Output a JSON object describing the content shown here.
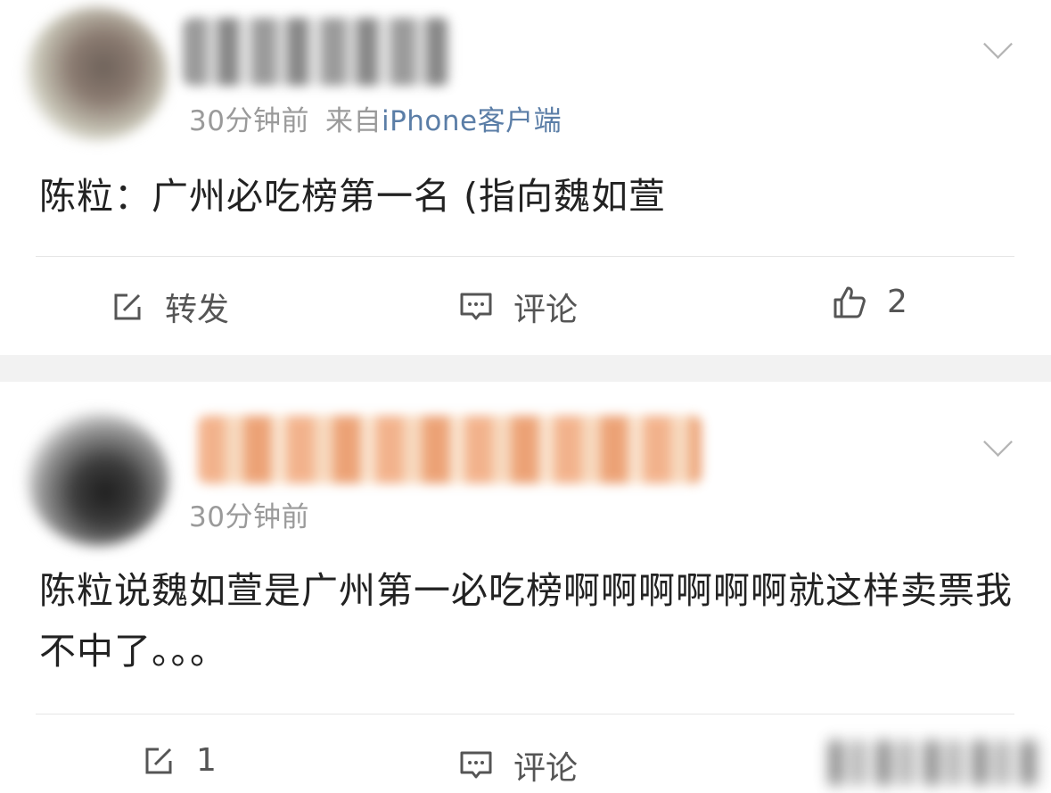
{
  "posts": [
    {
      "time": "30分钟前",
      "source_prefix": "来自",
      "source_client": "iPhone客户端",
      "content": "陈粒：广州必吃榜第一名 (指向魏如萱",
      "actions": {
        "repost": "转发",
        "comment": "评论",
        "like": "2"
      }
    },
    {
      "time": "30分钟前",
      "content": "陈粒说魏如萱是广州第一必吃榜啊啊啊啊啊啊就这样卖票我不中了。。。",
      "actions": {
        "repost": "1",
        "comment": "评论"
      }
    }
  ],
  "colors": {
    "link": "#5b7ea7",
    "meta": "#9a9a9a",
    "text": "#222222",
    "separator": "#f2f2f2"
  },
  "icons": {
    "repost": "edit-square-icon",
    "comment": "comment-bubble-icon",
    "like": "thumbs-up-icon",
    "menu": "chevron-down-icon"
  }
}
